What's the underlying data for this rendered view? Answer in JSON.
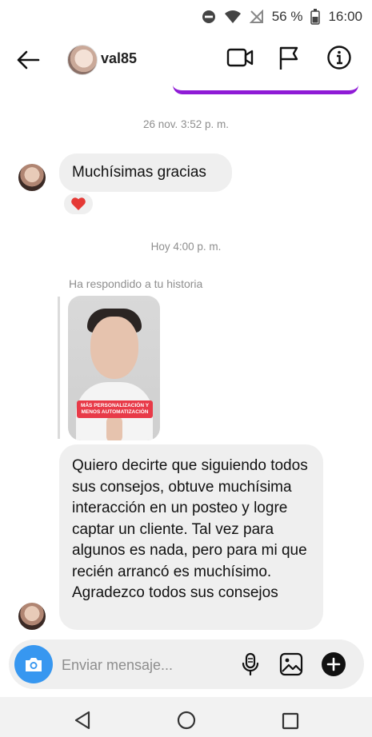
{
  "status_bar": {
    "battery_text": "56 %",
    "time": "16:00",
    "icons": [
      "do-not-disturb-icon",
      "wifi-icon",
      "no-signal-icon",
      "battery-icon"
    ]
  },
  "header": {
    "username": "val85",
    "icons": [
      "back-arrow-icon",
      "video-call-icon",
      "flag-icon",
      "info-icon"
    ]
  },
  "conversation": {
    "timestamp_1": "26 nov. 3:52 p. m.",
    "message_1": "Muchísimas gracias",
    "reaction_1": "heart",
    "timestamp_2": "Hoy 4:00 p. m.",
    "story_reply_label": "Ha respondido a tu historia",
    "story_caption": "MÁS PERSONALIZACIÓN Y MENOS AUTOMATIZACIÓN",
    "message_2": "Quiero decirte que siguiendo todos sus consejos, obtuve muchísima interacción en un posteo y logre captar un cliente. Tal vez para algunos es nada, pero para mi que recién arrancó es muchísimo. Agradezco todos sus consejos"
  },
  "composer": {
    "placeholder": "Enviar mensaje...",
    "icons": [
      "camera-icon",
      "microphone-icon",
      "gallery-icon",
      "plus-icon"
    ]
  },
  "colors": {
    "accent_blue": "#3797f0",
    "purple_bubble": "#8f1bd6",
    "bubble_gray": "#efefef",
    "heart_red": "#e53935"
  }
}
